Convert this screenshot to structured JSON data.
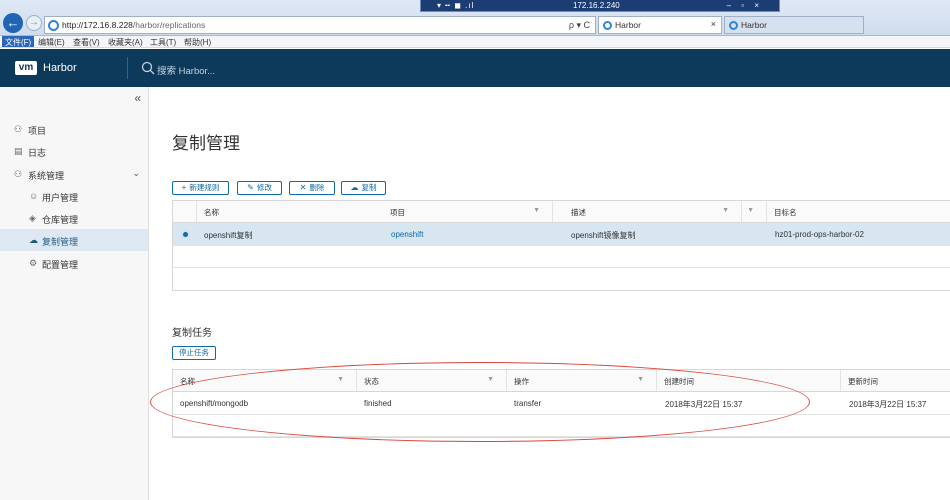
{
  "remote": {
    "left": "▾ ╍ ◼ .ıl",
    "ip": "172.16.2.240",
    "right": "– ▫ ×"
  },
  "browser": {
    "url_host": "http://172.16.8.228",
    "url_path": "/harbor/replications",
    "addr_tools": "ρ ▾ C",
    "tabs": [
      {
        "label": "Harbor",
        "close": "×"
      },
      {
        "label": "Harbor"
      }
    ],
    "menu": [
      "文件(F)",
      "编辑(E)",
      "查看(V)",
      "收藏夹(A)",
      "工具(T)",
      "帮助(H)"
    ]
  },
  "header": {
    "logo": "vm",
    "brand": "Harbor",
    "search_placeholder": "搜索 Harbor..."
  },
  "sidebar": {
    "collapse": "«",
    "items": [
      {
        "label": "项目",
        "icon": "projects-icon"
      },
      {
        "label": "日志",
        "icon": "log-icon"
      },
      {
        "label": "系统管理",
        "icon": "admin-icon",
        "chevron": "⌄"
      },
      {
        "label": "用户管理",
        "icon": "users-icon"
      },
      {
        "label": "仓库管理",
        "icon": "registry-icon"
      },
      {
        "label": "复制管理",
        "icon": "replication-icon"
      },
      {
        "label": "配置管理",
        "icon": "config-icon"
      }
    ]
  },
  "main": {
    "title": "复制管理",
    "toolbar": {
      "new": "新建规则",
      "edit": "修改",
      "delete": "删除",
      "replicate": "复制"
    },
    "rules_table": {
      "columns": [
        "名称",
        "项目",
        "描述",
        "目标名"
      ],
      "rows": [
        {
          "name": "openshift复制",
          "project": "openshift",
          "desc": "openshift镜像复制",
          "target": "hz01-prod-ops-harbor-02"
        }
      ]
    },
    "jobs_title": "复制任务",
    "stop_label": "停止任务",
    "jobs_table": {
      "columns": [
        "名称",
        "状态",
        "操作",
        "创建时间",
        "更新时间"
      ],
      "rows": [
        {
          "name": "openshift/mongodb",
          "status": "finished",
          "op": "transfer",
          "created": "2018年3月22日 15:37",
          "updated": "2018年3月22日 15:37"
        }
      ]
    }
  },
  "colors": {
    "header_bg": "#0d3a5a",
    "accent": "#0f6aa8",
    "annotation": "#d9453b"
  }
}
